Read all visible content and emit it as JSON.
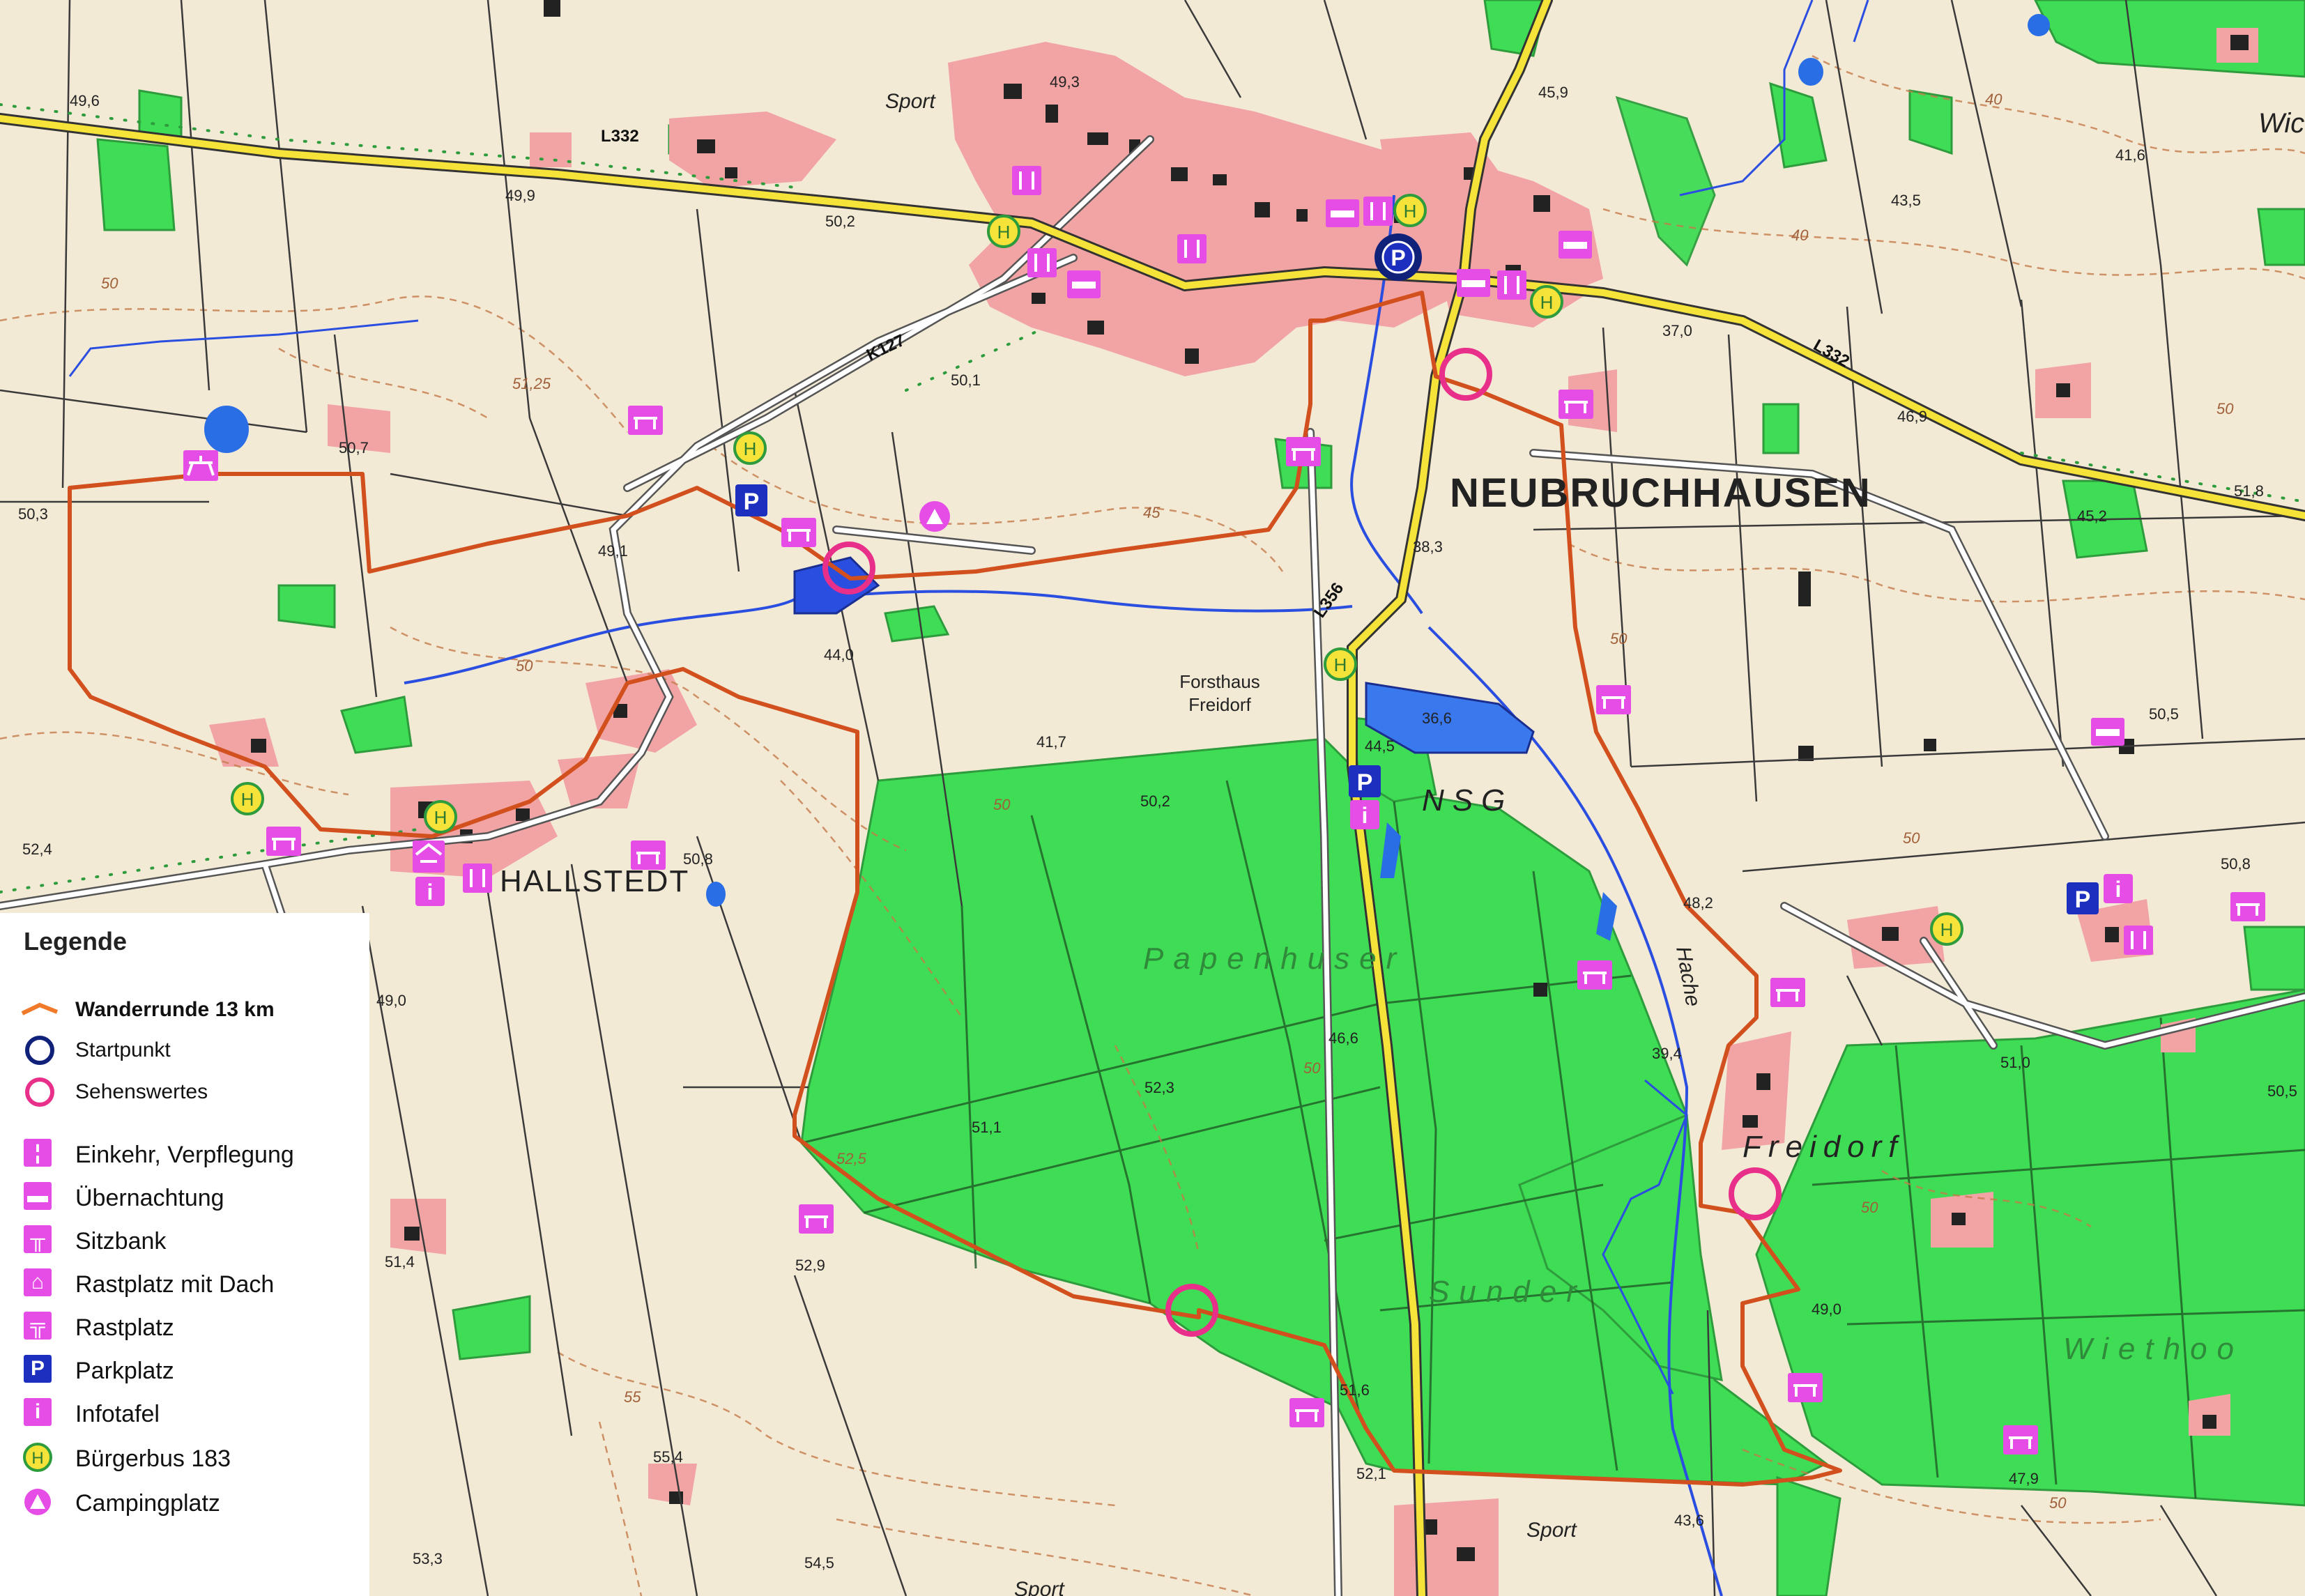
{
  "map": {
    "towns": {
      "neubruchhausen": "NEUBRUCHHAUSEN",
      "hallstedt": "HALLSTEDT",
      "freidorf": "Freidorf",
      "forsthaus_line1": "Forsthaus",
      "forsthaus_line2": "Freidorf",
      "wic": "Wic"
    },
    "forests": {
      "papenhuser": "Papenhuser",
      "sunder": "Sunder",
      "wiethoo": "Wiethoo"
    },
    "water": {
      "hache": "Hache",
      "nsg": "NSG",
      "lake": "36,6"
    },
    "roads": {
      "l332_west": "L332",
      "l332_east": "L332",
      "k127": "K127",
      "l356": "L356"
    },
    "sport_labels": [
      "Sport",
      "Sport",
      "Sport"
    ],
    "elevations": [
      "49,6",
      "49,3",
      "45,9",
      "41,6",
      "49,9",
      "50,2",
      "43,5",
      "37,0",
      "46,9",
      "51,8",
      "45,2",
      "50,7",
      "50,3",
      "49,1",
      "50,1",
      "38,3",
      "44,0",
      "41,7",
      "44,5",
      "50,2",
      "50,5",
      "52,4",
      "50,8",
      "48,2",
      "50,8",
      "49,0",
      "46,6",
      "52,3",
      "39,4",
      "51,0",
      "50,5",
      "51,1",
      "52,9",
      "51,4",
      "51,6",
      "49,0",
      "47,9",
      "52,1",
      "43,6",
      "55,4",
      "53,3",
      "54,5"
    ],
    "contour_labels": [
      "50",
      "45",
      "40",
      "40",
      "50",
      "50",
      "55",
      "50",
      "52,5",
      "50",
      "50",
      "50",
      "51,25",
      "50",
      "50"
    ],
    "symbols": {
      "parking": "P",
      "info": "i",
      "bus": "H"
    }
  },
  "legend": {
    "title": "Legende",
    "items": [
      {
        "label": "Wanderrunde 13 km",
        "icon": "orange-route-line"
      },
      {
        "label": "Startpunkt",
        "icon": "navy-ring"
      },
      {
        "label": "Sehenswertes",
        "icon": "pink-ring"
      },
      {
        "label": "Einkehr, Verpflegung",
        "icon": "fork-knife-icon"
      },
      {
        "label": "Übernachtung",
        "icon": "bed-icon"
      },
      {
        "label": "Sitzbank",
        "icon": "bench-icon"
      },
      {
        "label": "Rastplatz mit Dach",
        "icon": "shelter-icon"
      },
      {
        "label": "Rastplatz",
        "icon": "picnic-table-icon"
      },
      {
        "label": "Parkplatz",
        "icon": "parking-icon"
      },
      {
        "label": "Infotafel",
        "icon": "info-icon"
      },
      {
        "label": "Bürgerbus 183",
        "icon": "bus-stop-icon"
      },
      {
        "label": "Campingplatz",
        "icon": "camping-icon"
      }
    ]
  },
  "colors": {
    "background": "#f3ead6",
    "forest": "#3fdc55",
    "route": "#d2501e",
    "settlement": "#f2a3a3",
    "road_yellow": "#f5e33a",
    "water": "#2a4ee0",
    "poi_magenta": "#e64ce6",
    "parking_blue": "#1d2fbf",
    "start_ring": "#10217a",
    "sight_ring": "#e8308a"
  }
}
